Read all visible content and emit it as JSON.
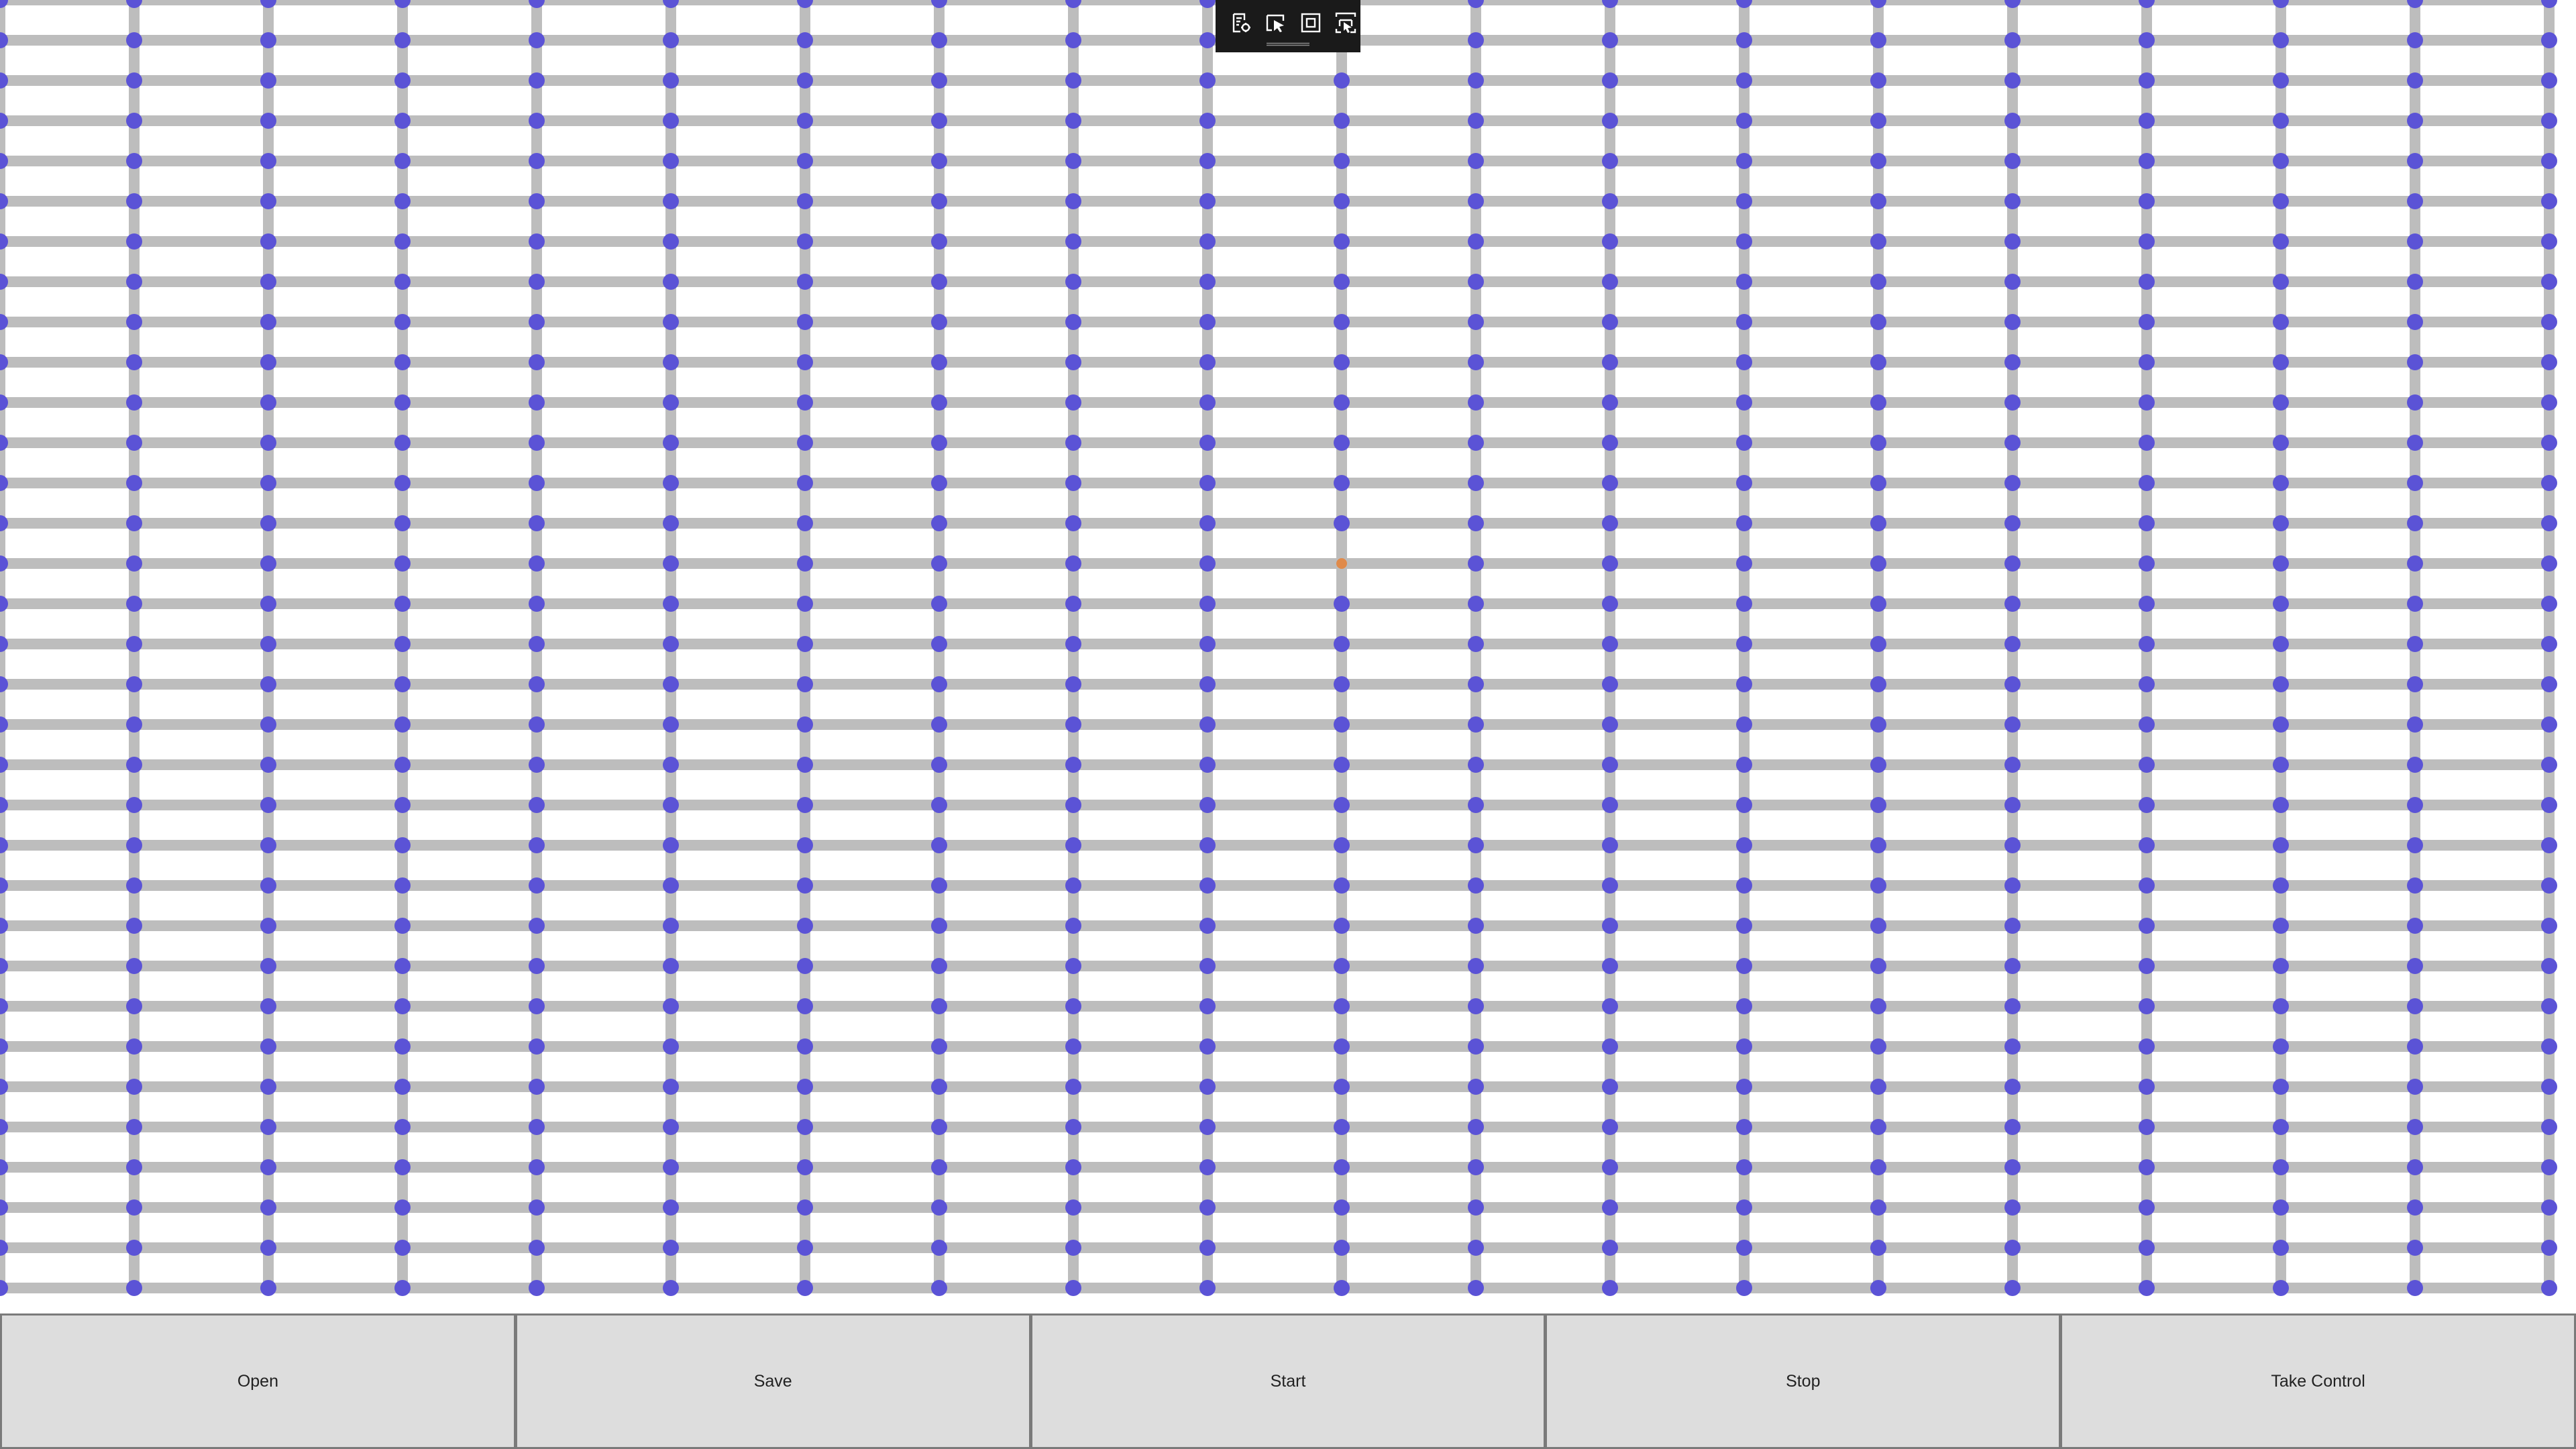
{
  "canvas": {
    "grid": {
      "columns": 20,
      "rows": 33,
      "line_color": "#bdbdbd",
      "node_color": "#5b53d6",
      "highlight_color": "#e08a4a",
      "highlighted_node": {
        "column": 10,
        "row": 14
      }
    }
  },
  "toolbar": {
    "icons": [
      {
        "name": "edit-document-icon"
      },
      {
        "name": "select-cursor-icon"
      },
      {
        "name": "fit-frame-icon"
      },
      {
        "name": "screen-capture-icon"
      }
    ]
  },
  "bottom_bar": {
    "buttons": [
      {
        "label": "Open"
      },
      {
        "label": "Save"
      },
      {
        "label": "Start"
      },
      {
        "label": "Stop"
      },
      {
        "label": "Take Control"
      }
    ]
  }
}
